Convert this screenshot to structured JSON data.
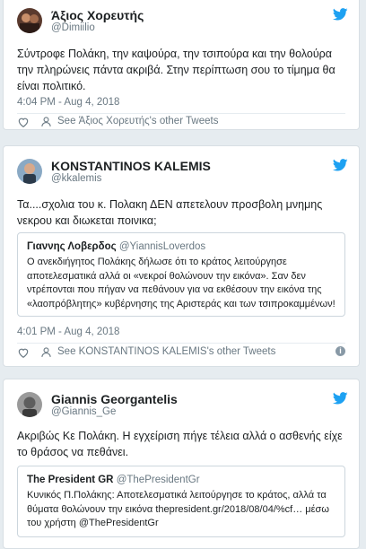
{
  "colors": {
    "twitter_blue": "#1da1f2",
    "secondary_text": "#697882",
    "link": "#2b7bb9"
  },
  "tweets": [
    {
      "name": "Άξιος Χορευτής",
      "handle": "@Dimiilio",
      "text": "Σύντροφε Πολάκη, την καψούρα, την τσιπούρα και την θολούρα την πληρώνεις πάντα ακριβά. Στην περίπτωση σου το τίμημα θα είναι πολιτικό.",
      "time": "4:04 PM - Aug 4, 2018",
      "other_tweets": "See Άξιος Χορευτής's other Tweets"
    },
    {
      "name": "KONSTANTINOS KALEMIS",
      "handle": "@kkalemis",
      "text": "Τα....σχολια του κ. Πολακη ΔΕΝ απετελουν προσβολη μνημης νεκρου και διωκεται ποινικα;",
      "quote": {
        "name": "Γιαννης Λοβερδος",
        "handle": "@YiannisLoverdos",
        "text": "Ο ανεκδιήγητος Πολάκης δήλωσε ότι το κράτος λειτούργησε αποτελεσματικά αλλά οι «νεκροί θολώνουν την εικόνα». Σαν δεν ντρέπονται που πήγαν να πεθάνουν για να εκθέσουν την εικόνα της «λαοπρόβλητης» κυβέρνησης της Αριστεράς και των τσιπροκαμμένων!"
      },
      "time": "4:01 PM - Aug 4, 2018",
      "other_tweets": "See KONSTANTINOS KALEMIS's other Tweets",
      "info_icon": "i"
    },
    {
      "name": "Giannis Georgantelis",
      "handle": "@Giannis_Ge",
      "text": "Ακριβώς Κε Πολάκη. Η εγχείριση πήγε τέλεια αλλά ο ασθενής είχε το θράσος να πεθάνει.",
      "quote": {
        "name": "The President GR",
        "handle": "@ThePresidentGr",
        "text_before": "Κυνικός Π.Πολάκης: Αποτελεσματικά λειτούργησε το κράτος, αλλά τα θύματα θολώνουν την εικόνα ",
        "link": "thepresident.gr/2018/08/04/%cf…",
        "text_middle": " μέσω του χρήστη ",
        "mention": "@ThePresidentGr"
      }
    }
  ]
}
